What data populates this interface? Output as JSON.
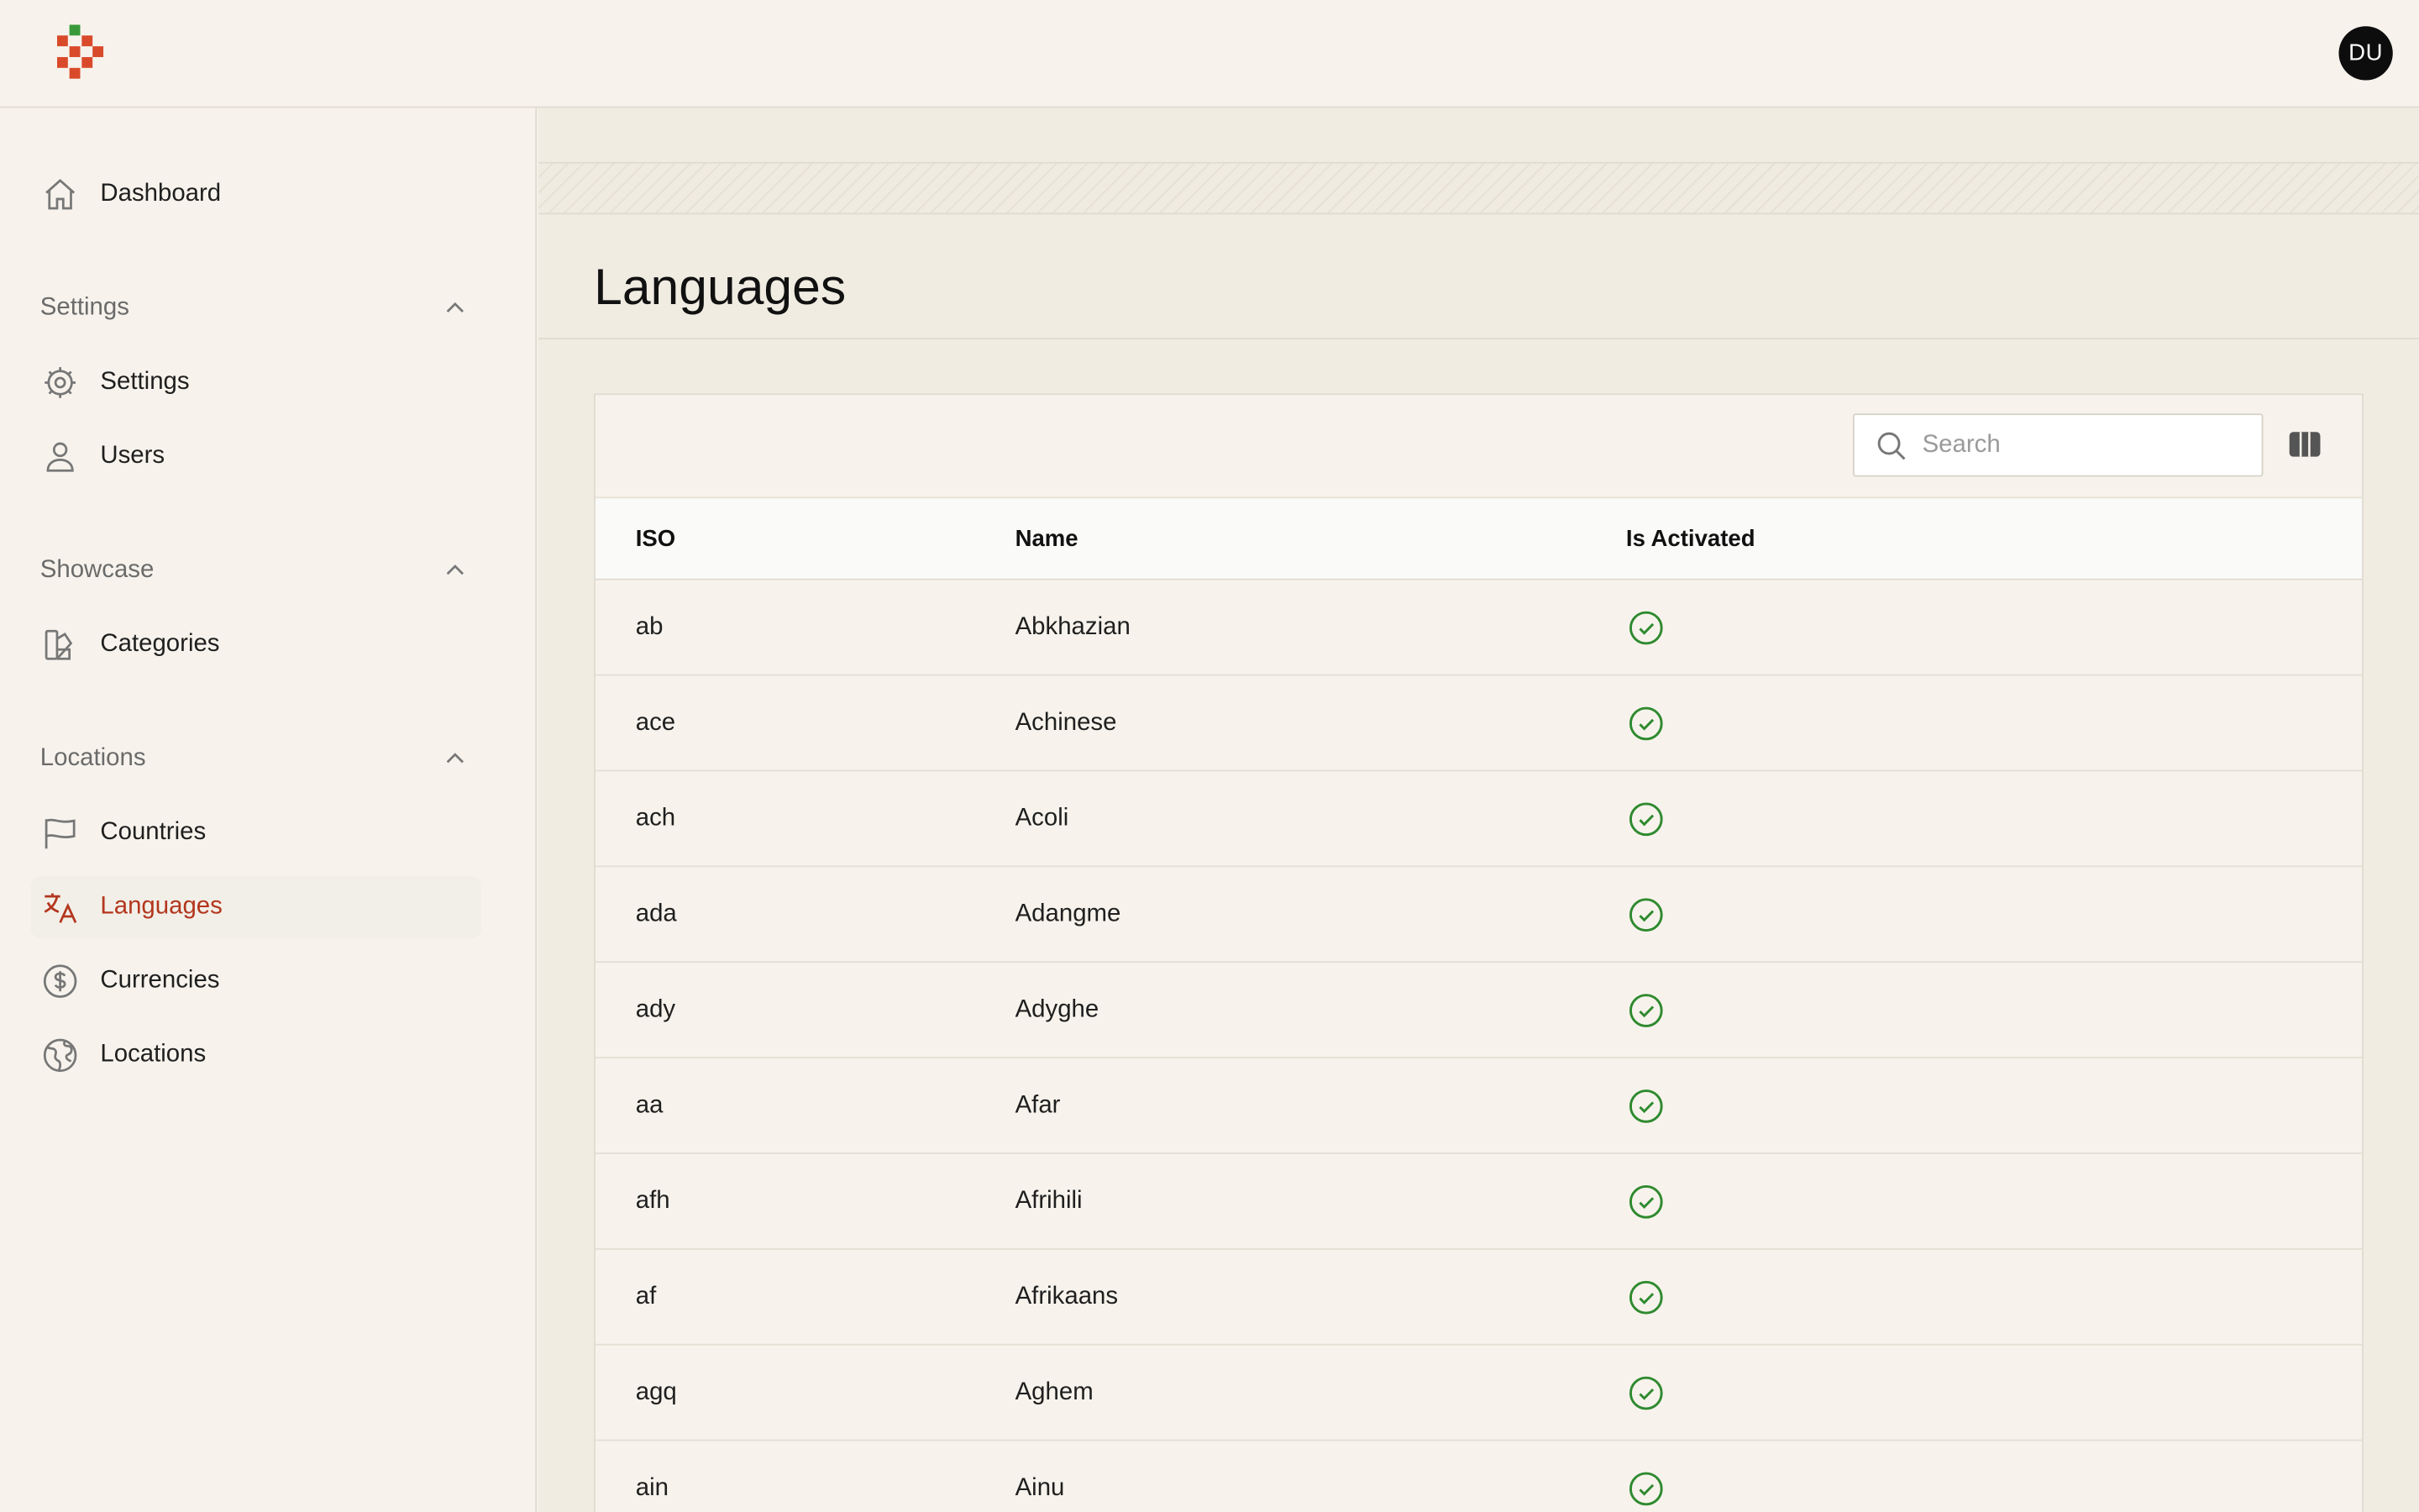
{
  "header": {
    "avatar_initials": "DU"
  },
  "sidebar": {
    "dashboard": {
      "label": "Dashboard",
      "icon": "home-icon"
    },
    "sections": [
      {
        "title": "Settings",
        "items": [
          {
            "label": "Settings",
            "icon": "gear-icon"
          },
          {
            "label": "Users",
            "icon": "user-icon"
          }
        ]
      },
      {
        "title": "Showcase",
        "items": [
          {
            "label": "Categories",
            "icon": "swatch-icon"
          }
        ]
      },
      {
        "title": "Locations",
        "items": [
          {
            "label": "Countries",
            "icon": "flag-icon"
          },
          {
            "label": "Languages",
            "icon": "translate-icon",
            "active": true
          },
          {
            "label": "Currencies",
            "icon": "dollar-icon"
          },
          {
            "label": "Locations",
            "icon": "globe-icon"
          }
        ]
      }
    ]
  },
  "main": {
    "title": "Languages",
    "search": {
      "placeholder": "Search",
      "value": ""
    },
    "table": {
      "columns": [
        "ISO",
        "Name",
        "Is Activated"
      ],
      "rows": [
        {
          "iso": "ab",
          "name": "Abkhazian",
          "activated": true
        },
        {
          "iso": "ace",
          "name": "Achinese",
          "activated": true
        },
        {
          "iso": "ach",
          "name": "Acoli",
          "activated": true
        },
        {
          "iso": "ada",
          "name": "Adangme",
          "activated": true
        },
        {
          "iso": "ady",
          "name": "Adyghe",
          "activated": true
        },
        {
          "iso": "aa",
          "name": "Afar",
          "activated": true
        },
        {
          "iso": "afh",
          "name": "Afrihili",
          "activated": true
        },
        {
          "iso": "af",
          "name": "Afrikaans",
          "activated": true
        },
        {
          "iso": "agq",
          "name": "Aghem",
          "activated": true
        },
        {
          "iso": "ain",
          "name": "Ainu",
          "activated": true
        }
      ]
    }
  },
  "colors": {
    "accent": "#b3361e",
    "check": "#2f8a2f",
    "background": "#f7f3ec"
  }
}
